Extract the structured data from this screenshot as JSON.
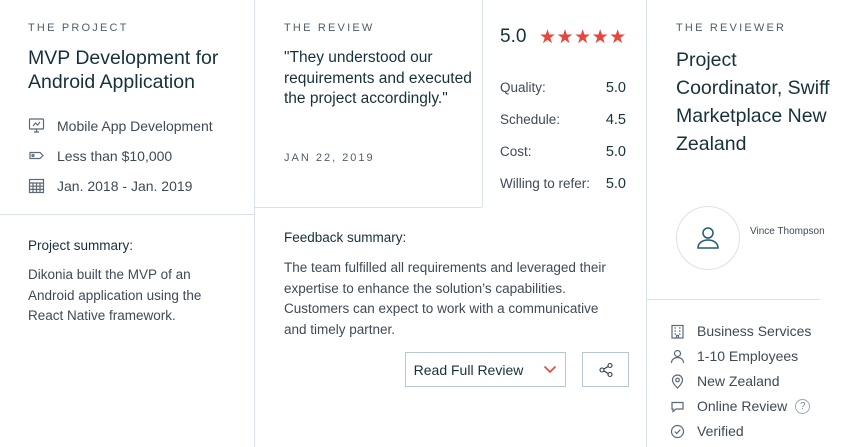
{
  "project": {
    "eyebrow": "THE PROJECT",
    "title": "MVP Development for Android Application",
    "category": "Mobile App Development",
    "budget": "Less than $10,000",
    "dates": "Jan. 2018 - Jan. 2019",
    "summary_label": "Project summary:",
    "summary_text": "Dikonia built the MVP of an Android application using the React Native framework."
  },
  "review": {
    "eyebrow": "THE REVIEW",
    "quote": "\"They understood our requirements and executed the project accordingly.\"",
    "date": "JAN 22, 2019",
    "overall_score": "5.0",
    "stars": "★★★★★",
    "ratings": [
      {
        "label": "Quality:",
        "value": "5.0"
      },
      {
        "label": "Schedule:",
        "value": "4.5"
      },
      {
        "label": "Cost:",
        "value": "5.0"
      },
      {
        "label": "Willing to refer:",
        "value": "5.0"
      }
    ],
    "feedback_label": "Feedback summary:",
    "feedback_text": "The team fulfilled all requirements and leveraged their expertise to enhance the solution’s capabilities. Customers can expect to work with a communicative and timely partner.",
    "read_full_label": "Read Full Review"
  },
  "reviewer": {
    "eyebrow": "THE REVIEWER",
    "title": "Project Coordinator, Swiff Marketplace New Zealand",
    "name": "Vince Thompson",
    "industry": "Business Services",
    "employees": "1-10 Employees",
    "location": "New Zealand",
    "review_type": "Online Review",
    "help_mark": "?",
    "status": "Verified"
  },
  "colors": {
    "star": "#e8453c",
    "divider": "#d9e2ea",
    "button_border": "#b6c8d6"
  },
  "icons": [
    "monitor-icon",
    "tag-icon",
    "calendar-icon",
    "chevron-down-icon",
    "share-icon",
    "user-icon",
    "building-icon",
    "person-icon",
    "location-pin-icon",
    "chat-bubble-icon",
    "help-icon",
    "check-circle-icon"
  ]
}
